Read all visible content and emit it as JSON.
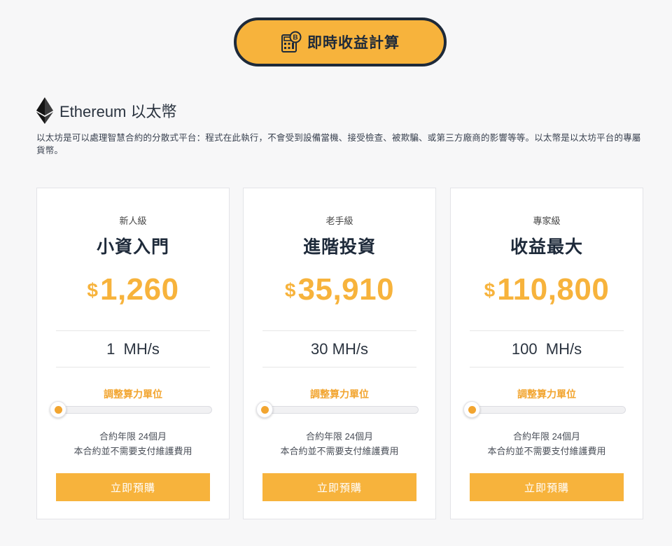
{
  "calculator_button": {
    "label": "即時收益計算",
    "icon": "bitcoin-calculator-icon"
  },
  "heading": {
    "icon": "ethereum-icon",
    "title": "Ethereum 以太幣",
    "description": "以太坊是可以處理智慧合約的分散式平台：程式在此執行，不會受到設備當機、接受檢查、被欺騙、或第三方廠商的影響等等。以太幣是以太坊平台的專屬貨幣。"
  },
  "colors": {
    "accent": "#f7b33c",
    "dark": "#1e2a3a",
    "adjust_text": "#f2a530"
  },
  "plans": [
    {
      "level": "新人級",
      "name": "小資入門",
      "currency": "$",
      "price": "1,260",
      "hashrate": "1  MH/s",
      "adjust_label": "調整算力單位",
      "slider_value": 0,
      "term_line1": "合約年限 24個月",
      "term_line2": "本合約並不需要支付維護費用",
      "buy_label": "立即預購"
    },
    {
      "level": "老手級",
      "name": "進階投資",
      "currency": "$",
      "price": "35,910",
      "hashrate": "30 MH/s",
      "adjust_label": "調整算力單位",
      "slider_value": 0,
      "term_line1": "合約年限 24個月",
      "term_line2": "本合約並不需要支付維護費用",
      "buy_label": "立即預購"
    },
    {
      "level": "專家級",
      "name": "收益最大",
      "currency": "$",
      "price": "110,800",
      "hashrate": "100  MH/s",
      "adjust_label": "調整算力單位",
      "slider_value": 0,
      "term_line1": "合約年限 24個月",
      "term_line2": "本合約並不需要支付維護費用",
      "buy_label": "立即預購"
    }
  ]
}
